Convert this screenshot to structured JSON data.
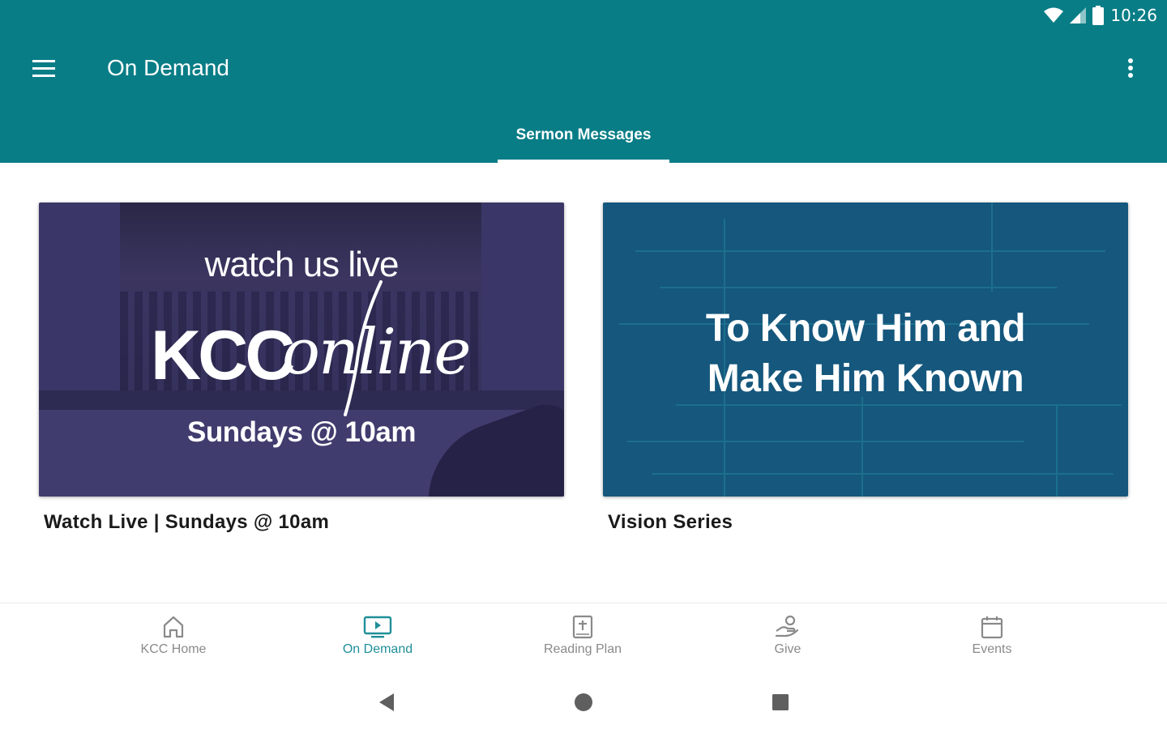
{
  "status_bar": {
    "time": "10:26",
    "icons": [
      "wifi-icon",
      "cell-signal-icon",
      "battery-icon"
    ]
  },
  "appbar": {
    "title": "On Demand",
    "menu_icon": "hamburger-menu-icon",
    "overflow_icon": "more-vert-icon",
    "color": "#087d86"
  },
  "tabs": [
    {
      "label": "Sermon Messages",
      "selected": true
    }
  ],
  "cards": [
    {
      "title": "Watch Live | Sundays @ 10am",
      "thumbnail": {
        "line1": "watch us live",
        "brand": "KCC",
        "brand_script": "online",
        "line3": "Sundays @ 10am"
      }
    },
    {
      "title": "Vision Series",
      "thumbnail": {
        "line1": "To Know Him and",
        "line2": "Make Him Known"
      }
    }
  ],
  "bottom_nav": {
    "items": [
      {
        "label": "KCC Home",
        "icon": "home-icon",
        "active": false
      },
      {
        "label": "On Demand",
        "icon": "tv-play-icon",
        "active": true
      },
      {
        "label": "Reading Plan",
        "icon": "bible-icon",
        "active": false
      },
      {
        "label": "Give",
        "icon": "give-hand-icon",
        "active": false
      },
      {
        "label": "Events",
        "icon": "calendar-icon",
        "active": false
      }
    ],
    "active_color": "#1f8f99",
    "inactive_color": "#8a8a8a"
  },
  "system_nav": {
    "buttons": [
      "back-icon",
      "home-circle-icon",
      "recents-square-icon"
    ]
  }
}
